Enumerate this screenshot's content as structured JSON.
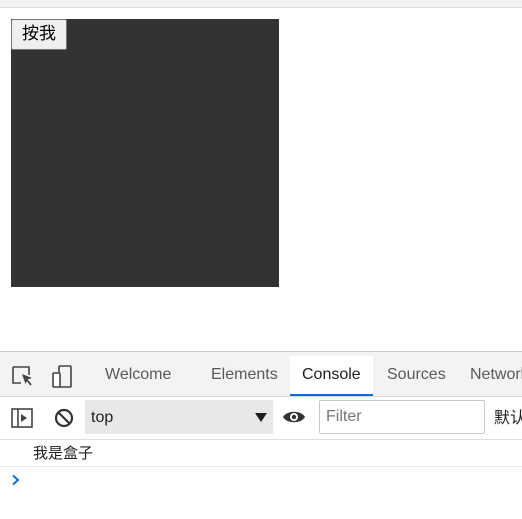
{
  "viewport": {
    "button_label": "按我",
    "box_color": "#333333"
  },
  "devtools": {
    "tools": [
      {
        "icon": "inspect-element-icon"
      },
      {
        "icon": "device-emulation-icon"
      }
    ],
    "tabs": [
      {
        "label": "Welcome",
        "active": false
      },
      {
        "label": "Elements",
        "active": false
      },
      {
        "label": "Console",
        "active": true
      },
      {
        "label": "Sources",
        "active": false
      },
      {
        "label": "Network",
        "active": false
      }
    ],
    "accent_color": "#0a6bd6",
    "console_toolbar": {
      "sidebar_icon": "show-console-sidebar-icon",
      "clear_icon": "clear-console-icon",
      "context": "top",
      "eye_icon": "live-expression-eye-icon",
      "filter_placeholder": "Filter",
      "levels_label": "默认级别"
    },
    "messages": [
      {
        "text": "我是盒子"
      }
    ],
    "prompt_icon": "chevron-right-icon"
  }
}
